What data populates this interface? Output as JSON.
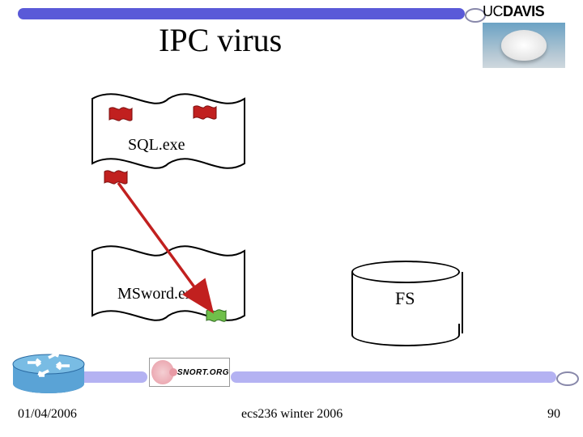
{
  "title": "IPC virus",
  "header": {
    "logo_thin": "UC",
    "logo_bold": "DAVIS"
  },
  "diagram": {
    "process1_label": "SQL.exe",
    "process2_label": "MSword.exe",
    "store_label": "FS",
    "snort_label": "SNORT.ORG"
  },
  "footer": {
    "date": "01/04/2006",
    "course": "ecs236 winter 2006",
    "page": "90"
  }
}
